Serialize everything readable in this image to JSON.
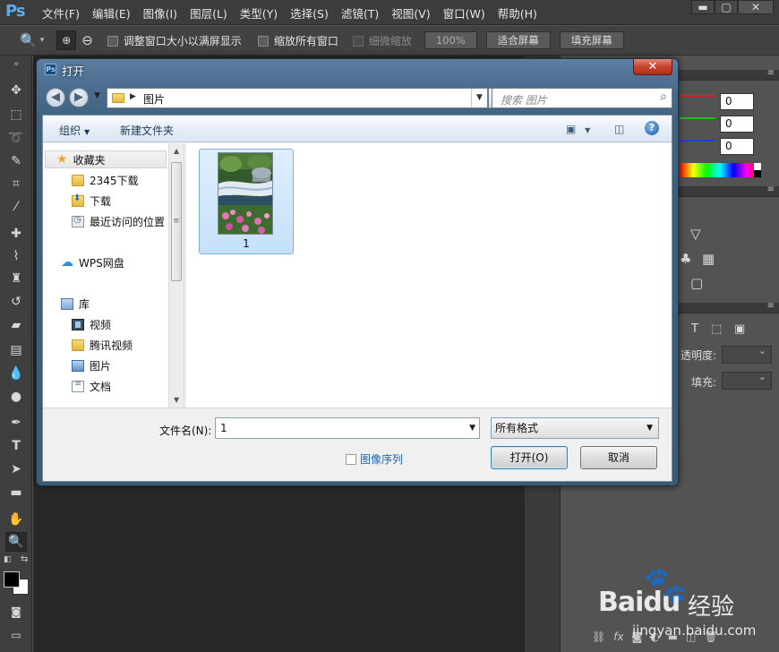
{
  "app": {
    "logo": "Ps",
    "menu": [
      "文件(F)",
      "编辑(E)",
      "图像(I)",
      "图层(L)",
      "类型(Y)",
      "选择(S)",
      "滤镜(T)",
      "视图(V)",
      "窗口(W)",
      "帮助(H)"
    ],
    "window_controls": {
      "minimize": "▬",
      "maximize": "▢",
      "close": "✕"
    }
  },
  "options_bar": {
    "resize_windows": "调整窗口大小以满屏显示",
    "zoom_all_windows": "缩放所有窗口",
    "scrubby_zoom": "细微缩放",
    "zoom_percent": "100%",
    "fit_screen": "适合屏幕",
    "fill_screen": "填充屏幕"
  },
  "right_panel": {
    "color_values": [
      "0",
      "0",
      "0"
    ],
    "slider_colors": [
      "#e0201e",
      "#1fbf1f",
      "#1f3fe0"
    ],
    "opacity_label": "透明度:",
    "fill_label": "填充:"
  },
  "dialog": {
    "title_icon": "Ps",
    "title": "打开",
    "close": "✕",
    "address_path": "图片",
    "search_placeholder": "搜索 图片",
    "toolbar": {
      "organize": "组织",
      "new_folder": "新建文件夹"
    },
    "nav": {
      "favorites": "收藏夹",
      "items_fav": [
        "2345下载",
        "下载",
        "最近访问的位置"
      ],
      "wps": "WPS网盘",
      "library": "库",
      "items_lib": [
        "视频",
        "腾讯视频",
        "图片",
        "文档"
      ]
    },
    "files": [
      {
        "name": "1"
      }
    ],
    "filename_label": "文件名(N):",
    "filename_value": "1",
    "filter_value": "所有格式",
    "image_sequence": "图像序列",
    "open_button": "打开(O)",
    "cancel_button": "取消"
  },
  "watermark": {
    "line1": "Baidu",
    "line2": "经验",
    "line3": "jingyan.baidu.com"
  },
  "accent_colors": {
    "ps_blue": "#5ea8e6",
    "dialog_frame": "#4b6e91",
    "selection": "#c6e1fb",
    "link": "#1a64b8"
  }
}
